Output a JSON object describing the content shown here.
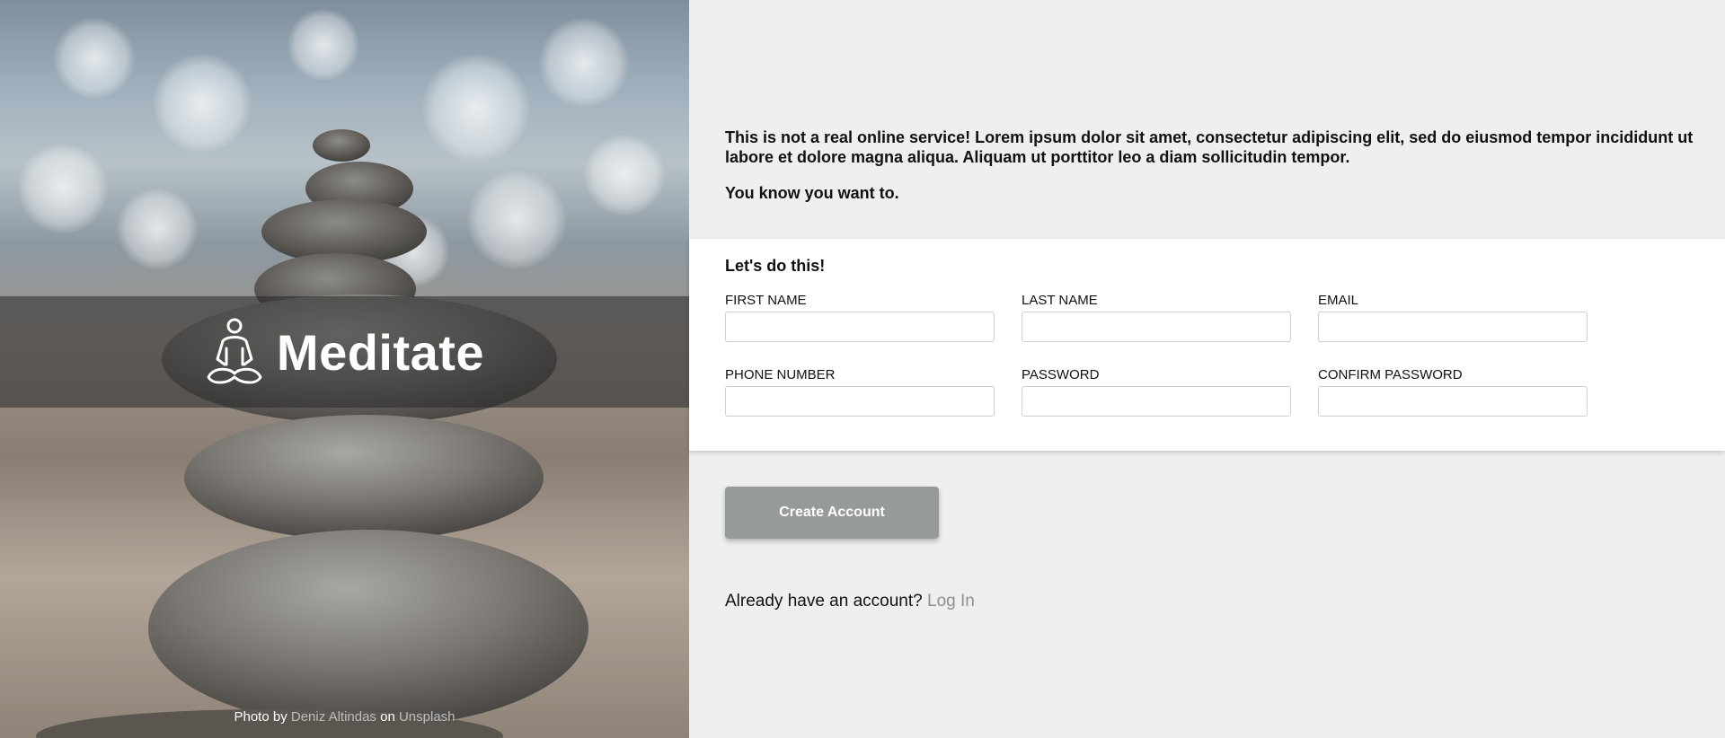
{
  "hero": {
    "brand": "Meditate",
    "credit": {
      "prefix": "Photo by",
      "author": "Deniz Altindas",
      "middle": "on",
      "source": "Unsplash"
    }
  },
  "intro": {
    "paragraph1": "This is not a real online service! Lorem ipsum dolor sit amet, consectetur adipiscing elit, sed do eiusmod tempor incididunt ut labore et dolore magna aliqua. Aliquam ut porttitor leo a diam sollicitudin tempor.",
    "paragraph2": "You know you want to."
  },
  "form": {
    "heading": "Let's do this!",
    "fields": {
      "first_name": {
        "label": "FIRST NAME",
        "value": ""
      },
      "last_name": {
        "label": "LAST NAME",
        "value": ""
      },
      "email": {
        "label": "EMAIL",
        "value": ""
      },
      "phone": {
        "label": "PHONE NUMBER",
        "value": ""
      },
      "password": {
        "label": "PASSWORD",
        "value": ""
      },
      "confirm_password": {
        "label": "CONFIRM PASSWORD",
        "value": ""
      }
    },
    "submit_label": "Create Account"
  },
  "login": {
    "prompt": "Already have an account?",
    "link_label": "Log In"
  },
  "colors": {
    "page_bg": "#efefef",
    "button_bg": "#979b98",
    "link": "#8f8f8f",
    "banner": "rgba(40,40,40,0.55)"
  },
  "icons": {
    "logo": "meditation-figure-icon"
  }
}
